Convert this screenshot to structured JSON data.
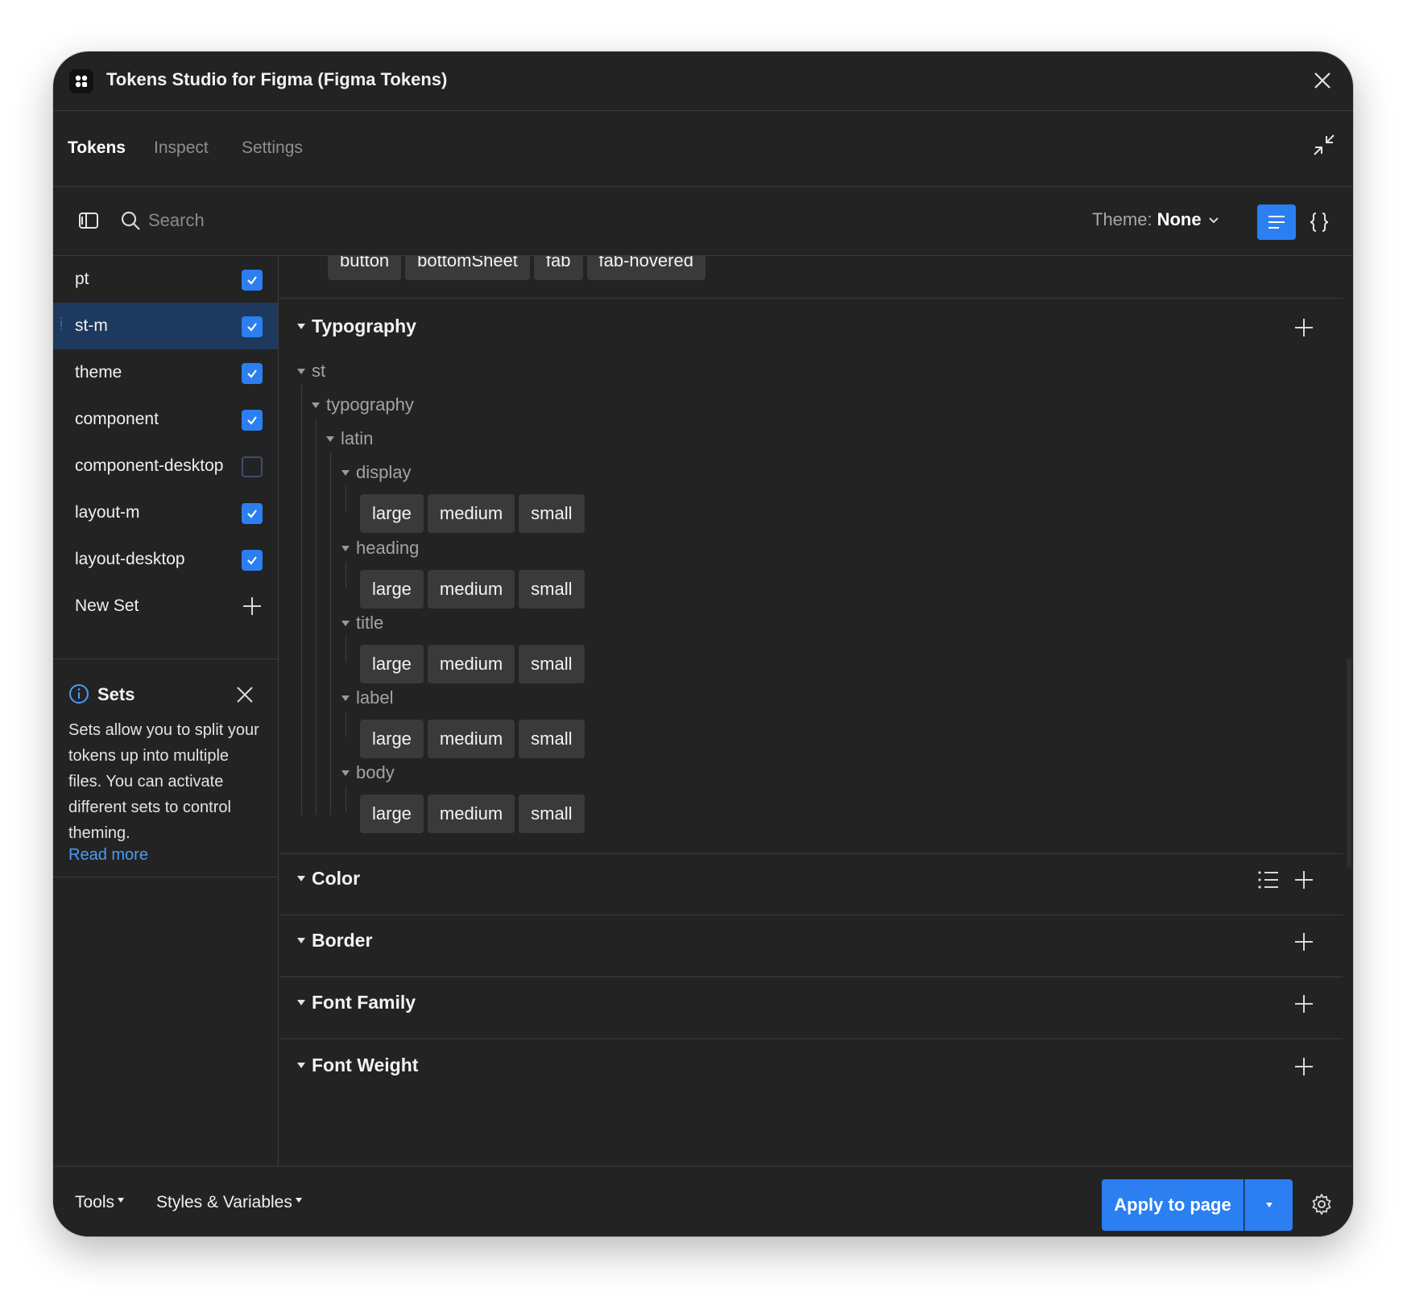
{
  "window": {
    "title": "Tokens Studio for Figma (Figma Tokens)"
  },
  "tabs": [
    {
      "label": "Tokens",
      "active": true
    },
    {
      "label": "Inspect",
      "active": false
    },
    {
      "label": "Settings",
      "active": false
    }
  ],
  "toolbar": {
    "search_placeholder": "Search",
    "theme_label": "Theme:",
    "theme_value": "None"
  },
  "sidebar": {
    "sets": [
      {
        "label": "pt",
        "checked": true,
        "active": false
      },
      {
        "label": "st-m",
        "checked": true,
        "active": true
      },
      {
        "label": "theme",
        "checked": true,
        "active": false
      },
      {
        "label": "component",
        "checked": true,
        "active": false
      },
      {
        "label": "component-desktop",
        "checked": false,
        "active": false
      },
      {
        "label": "layout-m",
        "checked": true,
        "active": false
      },
      {
        "label": "layout-desktop",
        "checked": true,
        "active": false
      }
    ],
    "new_set_label": "New Set",
    "info": {
      "title": "Sets",
      "text": "Sets allow you to split your tokens up into multiple files. You can activate different sets to control theming.",
      "link": "Read more"
    }
  },
  "main": {
    "top_chips": [
      "button",
      "bottomSheet",
      "fab",
      "fab-hovered"
    ],
    "typography": {
      "title": "Typography",
      "l1": "st",
      "l2": "typography",
      "l3": "latin",
      "groups": [
        {
          "name": "display",
          "tokens": [
            "large",
            "medium",
            "small"
          ]
        },
        {
          "name": "heading",
          "tokens": [
            "large",
            "medium",
            "small"
          ]
        },
        {
          "name": "title",
          "tokens": [
            "large",
            "medium",
            "small"
          ]
        },
        {
          "name": "label",
          "tokens": [
            "large",
            "medium",
            "small"
          ]
        },
        {
          "name": "body",
          "tokens": [
            "large",
            "medium",
            "small"
          ]
        }
      ]
    },
    "sections": [
      "Color",
      "Border",
      "Font Family",
      "Font Weight"
    ]
  },
  "footer": {
    "tools": "Tools",
    "styles": "Styles & Variables",
    "apply": "Apply to page"
  },
  "colors": {
    "accent": "#2b7ff0",
    "bg": "#232323",
    "active_row": "#1d3a5e",
    "link": "#4a9bf5"
  }
}
